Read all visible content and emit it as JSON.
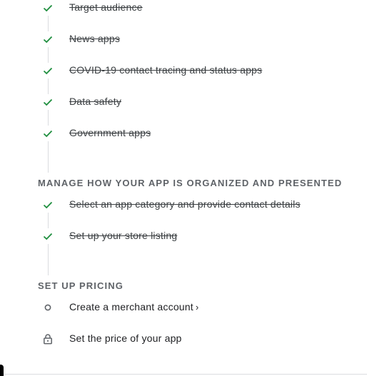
{
  "colors": {
    "check_green": "#1e8e3e",
    "rail": "#dadce0",
    "heading": "#5f6368"
  },
  "completed_group_1": [
    {
      "label": "Target audience",
      "icon": "check-icon"
    },
    {
      "label": "News apps",
      "icon": "check-icon"
    },
    {
      "label": "COVID-19 contact tracing and status apps",
      "icon": "check-icon"
    },
    {
      "label": "Data safety",
      "icon": "check-icon"
    },
    {
      "label": "Government apps",
      "icon": "check-icon"
    }
  ],
  "section_manage": {
    "heading": "MANAGE HOW YOUR APP IS ORGANIZED AND PRESENTED",
    "items": [
      {
        "label": "Select an app category and provide contact details",
        "icon": "check-icon"
      },
      {
        "label": "Set up your store listing",
        "icon": "check-icon"
      }
    ]
  },
  "section_pricing": {
    "heading": "SET UP PRICING",
    "items": [
      {
        "label": "Create a merchant account",
        "icon": "circle-icon",
        "chevron": "›"
      },
      {
        "label": "Set the price of your app",
        "icon": "lock-icon"
      }
    ]
  }
}
